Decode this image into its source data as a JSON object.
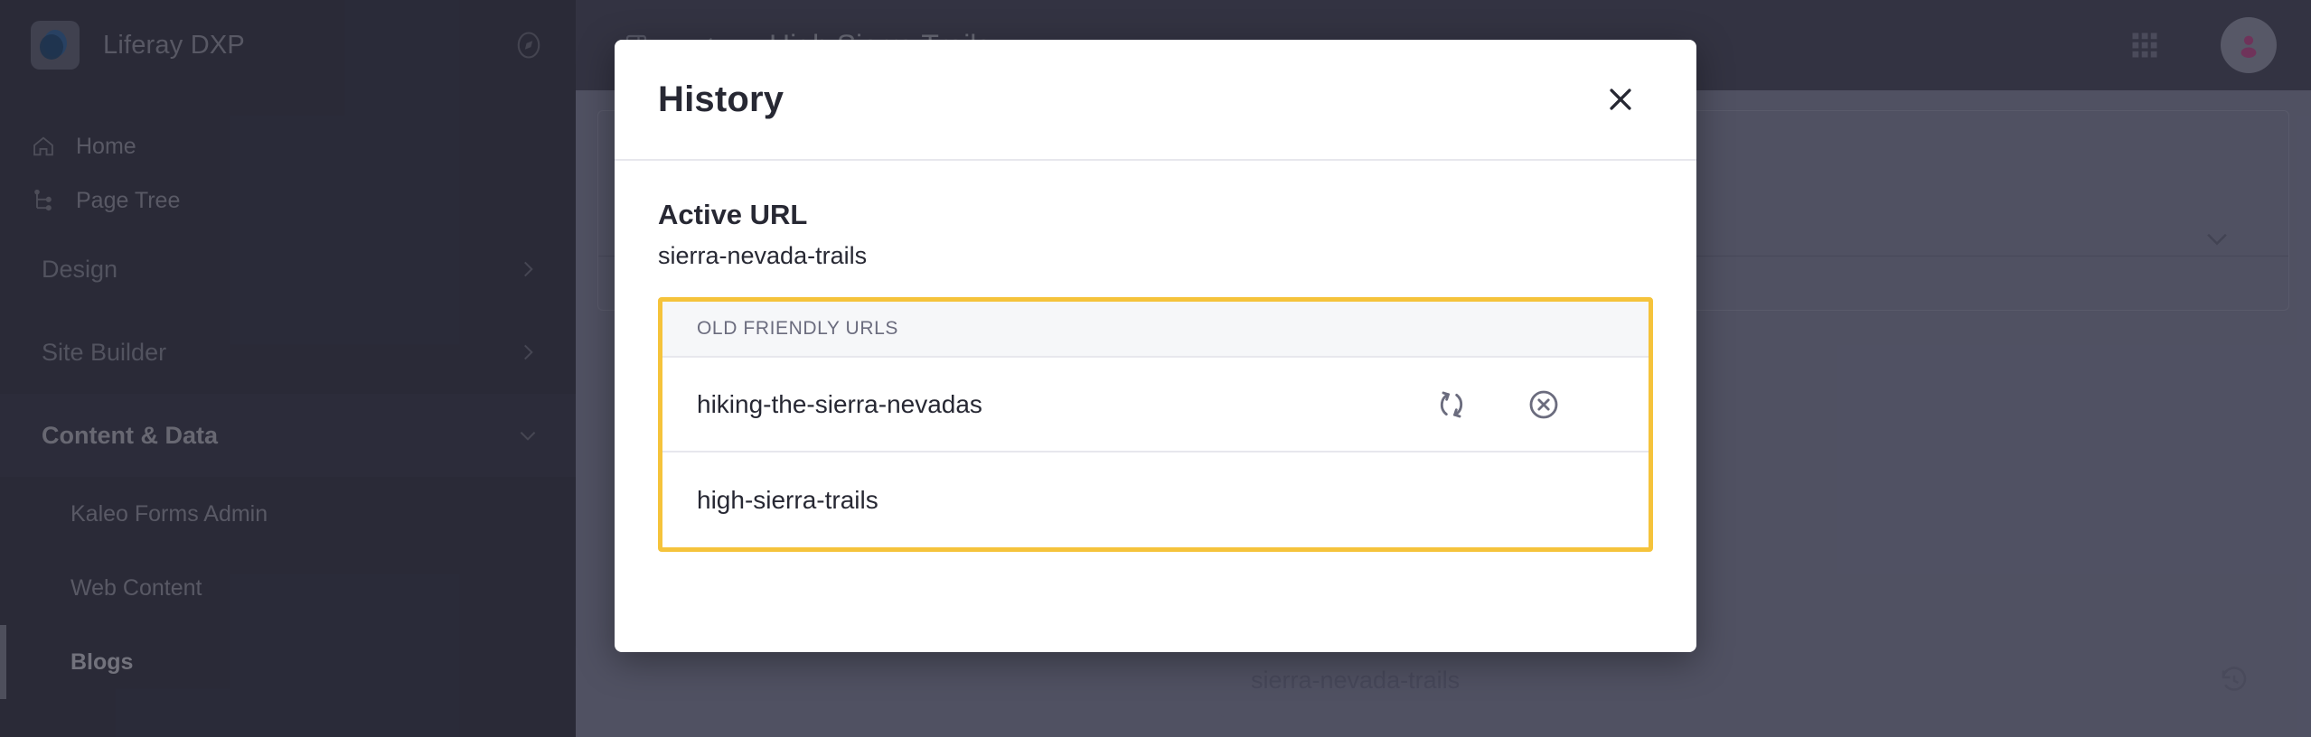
{
  "sidebar": {
    "brand": {
      "title": "Liferay DXP",
      "compass_icon": "compass-icon"
    },
    "items": [
      {
        "label": "Home",
        "icon": "home-icon"
      },
      {
        "label": "Page Tree",
        "icon": "page-tree-icon"
      }
    ],
    "sections": [
      {
        "label": "Design",
        "state": "collapsed",
        "chevron": "chevron-right-icon"
      },
      {
        "label": "Site Builder",
        "state": "collapsed",
        "chevron": "chevron-right-icon"
      },
      {
        "label": "Content & Data",
        "state": "expanded",
        "chevron": "chevron-down-icon"
      }
    ],
    "sub_items": [
      {
        "label": "Kaleo Forms Admin",
        "selected": false
      },
      {
        "label": "Web Content",
        "selected": false
      },
      {
        "label": "Blogs",
        "selected": true
      }
    ]
  },
  "topbar": {
    "panel_icon": "panel-toggle-icon",
    "back_icon": "chevron-left-icon",
    "title": "High Sierra Trails",
    "apps_icon": "grid-apps-icon",
    "avatar": "user-avatar-icon"
  },
  "background": {
    "collapse_chevron": "chevron-down-icon",
    "url_field": {
      "value": "sierra-nevada-trails",
      "history_icon": "history-clock-icon"
    }
  },
  "modal": {
    "title": "History",
    "close_icon": "close-icon",
    "active_url": {
      "label": "Active URL",
      "value": "sierra-nevada-trails"
    },
    "table": {
      "columns": [
        "Old Friendly URLs"
      ],
      "rows": [
        {
          "url": "hiking-the-sierra-nevadas",
          "actions": [
            {
              "name": "restore-icon",
              "label": "Restore"
            },
            {
              "name": "remove-circle-icon",
              "label": "Remove"
            }
          ]
        },
        {
          "url": "high-sierra-trails",
          "actions": []
        }
      ]
    }
  },
  "colors": {
    "highlight_border": "#F5C33B",
    "modal_bg": "#FFFFFF",
    "app_dark": "#393A4A",
    "text_dark": "#272833"
  }
}
